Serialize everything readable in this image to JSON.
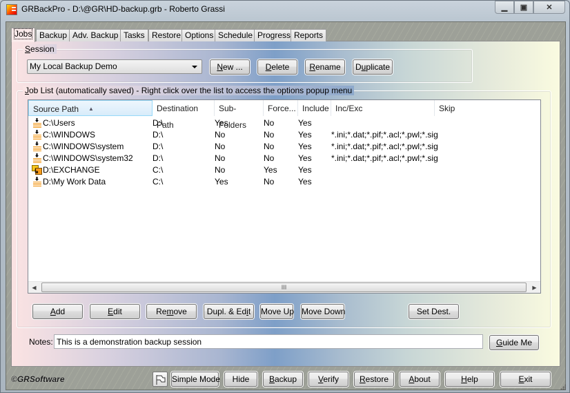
{
  "window": {
    "title": "GRBackPro - D:\\@GR\\HD-backup.grb - Roberto Grassi",
    "app_icon": "grbackpro-app-icon",
    "controls": {
      "minimize": "minimize-icon",
      "maximize": "maximize-icon",
      "close": "close-icon"
    }
  },
  "tabs": [
    {
      "label": "Jobs",
      "active": true
    },
    {
      "label": "Backup"
    },
    {
      "label": "Adv. Backup"
    },
    {
      "label": "Tasks"
    },
    {
      "label": "Restore"
    },
    {
      "label": "Options"
    },
    {
      "label": "Schedule"
    },
    {
      "label": "Progress"
    },
    {
      "label": "Reports"
    }
  ],
  "session": {
    "group_label_u": "S",
    "group_label_rest": "ession",
    "selected": "My Local Backup Demo",
    "buttons": {
      "new_u": "N",
      "new_rest": "ew ...",
      "delete_u": "D",
      "delete_rest": "elete",
      "rename_u": "R",
      "rename_rest": "ename",
      "duplicate_pre": "D",
      "duplicate_u": "u",
      "duplicate_rest": "plicate"
    }
  },
  "job_list": {
    "group_label_u": "J",
    "group_label_rest": "ob List (automatically saved) - Right click over the list to access the options popup menu",
    "columns": [
      "Source Path",
      "Destination Path",
      "Sub-Folders",
      "Force...",
      "Include",
      "Inc/Exc",
      "Skip"
    ],
    "sorted_column": "Source Path",
    "rows": [
      {
        "icon": "backup-job-icon",
        "source": "C:\\Users",
        "dest": "D:\\",
        "subfolders": "Yes",
        "force": "No",
        "include": "Yes",
        "incexc": "",
        "skip": ""
      },
      {
        "icon": "backup-job-icon",
        "source": "C:\\WINDOWS",
        "dest": "D:\\",
        "subfolders": "No",
        "force": "No",
        "include": "Yes",
        "incexc": "*.ini;*.dat;*.pif;*.acl;*.pwl;*.sig",
        "skip": ""
      },
      {
        "icon": "backup-job-icon",
        "source": "C:\\WINDOWS\\system",
        "dest": "D:\\",
        "subfolders": "No",
        "force": "No",
        "include": "Yes",
        "incexc": "*.ini;*.dat;*.pif;*.acl;*.pwl;*.sig",
        "skip": ""
      },
      {
        "icon": "backup-job-icon",
        "source": "C:\\WINDOWS\\system32",
        "dest": "D:\\",
        "subfolders": "No",
        "force": "No",
        "include": "Yes",
        "incexc": "*.ini;*.dat;*.pif;*.acl;*.pwl;*.sig",
        "skip": ""
      },
      {
        "icon": "exchange-job-icon",
        "source": "D:\\EXCHANGE",
        "dest": "C:\\",
        "subfolders": "No",
        "force": "Yes",
        "include": "Yes",
        "incexc": "",
        "skip": ""
      },
      {
        "icon": "backup-job-icon",
        "source": "D:\\My Work Data",
        "dest": "C:\\",
        "subfolders": "Yes",
        "force": "No",
        "include": "Yes",
        "incexc": "",
        "skip": ""
      }
    ],
    "scroll_thumb": "III",
    "buttons": {
      "add_u": "A",
      "add_rest": "dd",
      "edit_u": "E",
      "edit_rest": "dit",
      "remove_pre": "Re",
      "remove_u": "m",
      "remove_rest": "ove",
      "dupl_pre": "Dupl. & Ed",
      "dupl_u": "i",
      "dupl_rest": "t",
      "move_up": "Move Up",
      "move_down": "Move Down",
      "set_dest": "Set Dest."
    }
  },
  "notes": {
    "label": "Notes:",
    "value": "This is a demonstration backup session",
    "guide_u": "G",
    "guide_rest": "uide Me"
  },
  "footer": {
    "copyright": "©GRSoftware",
    "flag_icon": "flag-icon",
    "simple_mode": "Simple Mode",
    "hide": "Hide",
    "backup_u": "B",
    "backup_rest": "ackup",
    "verify_u": "V",
    "verify_rest": "erify",
    "restore_u": "R",
    "restore_rest": "estore",
    "about_u": "A",
    "about_rest": "bout",
    "help_u": "H",
    "help_rest": "elp",
    "exit_u": "E",
    "exit_rest": "xit"
  }
}
